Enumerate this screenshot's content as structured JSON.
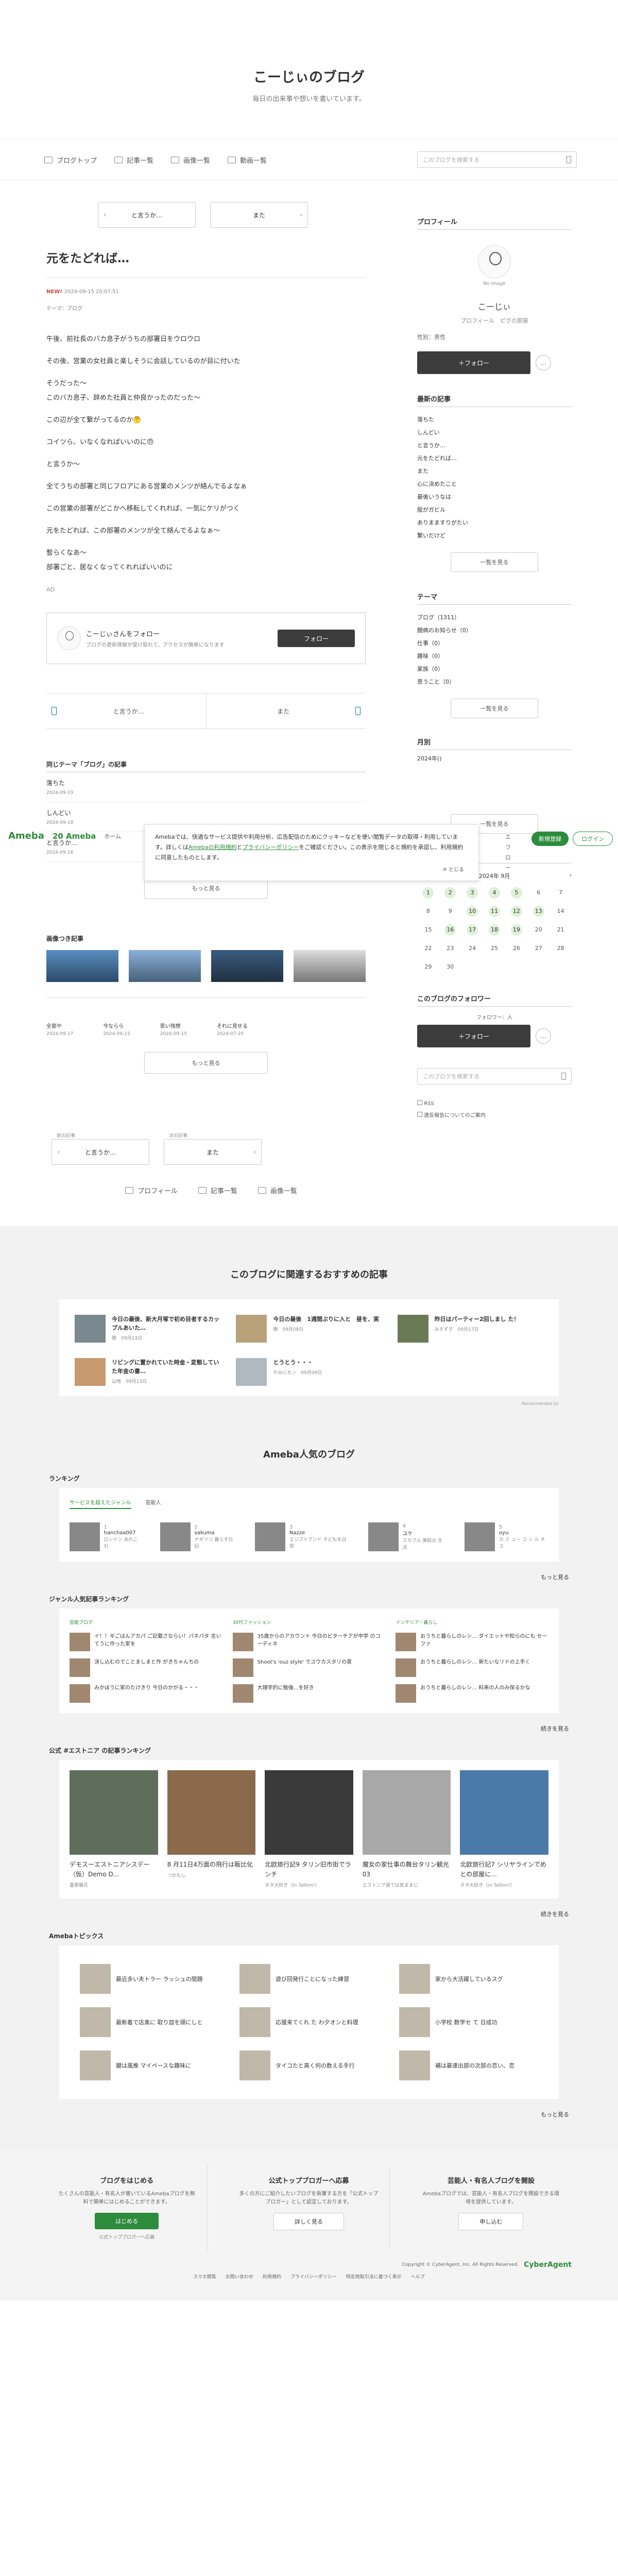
{
  "header": {
    "title": "こーじぃのブログ",
    "description": "毎日の出来事や想いを書いています。"
  },
  "nav": {
    "items": [
      {
        "label": "ブログトップ",
        "icon": "home-icon"
      },
      {
        "label": "記事一覧",
        "icon": "list-icon"
      },
      {
        "label": "画像一覧",
        "icon": "image-icon"
      },
      {
        "label": "動画一覧",
        "icon": "video-icon"
      }
    ],
    "search_placeholder": "このブログを検索する"
  },
  "pager": {
    "prev": "と言うか…",
    "next": "また"
  },
  "entry": {
    "title": "元をたどれば…",
    "new_badge": "NEW!",
    "date": "2024-09-15 20:07:51",
    "theme": "テーマ：ブログ",
    "paragraphs": [
      "午後、前社長のバカ息子がうちの部署日をウロウロ",
      "その後、営業の女社員と楽しそうに会話しているのが目に付いた",
      "そうだった〜\nこのバカ息子、辞めた社員と仲良かったのだった〜",
      "この辺が全て繋がってるのか🤔",
      "コイツら、いなくなればいいのに😠",
      "と言うか〜",
      "全てうちの部署と同じフロアにある営業のメンツが絡んでるよなぁ",
      "この営業の部署がどこかへ移転してくれれば、一気にケリがつく",
      "元をたどれば、この部署のメンツが全て絡んでるよなぁ〜",
      "暫らくなあ〜\n部署ごと、居なくなってくれればいいのに"
    ],
    "ad": "AD"
  },
  "profile": {
    "heading": "プロフィール",
    "no_image": "No Image",
    "name": "こーじぃ",
    "links": "プロフィール　ピグの部屋",
    "sex": "性別：男性",
    "follow": "＋フォロー",
    "more": "…"
  },
  "recent": {
    "heading": "最新の記事",
    "items": [
      "落ちた",
      "しんどい",
      "と言うか…",
      "元をたどれば…",
      "また",
      "心に決めたこと",
      "最後いうなは",
      "股がガビル",
      "ありまますりがたい",
      "繋いだけど"
    ],
    "more": "一覧を見る"
  },
  "theme": {
    "heading": "テーマ",
    "items": [
      "ブログ（1311）",
      "闘病のお知らせ（0）",
      "仕事（0）",
      "趣味（0）",
      "家族（0）",
      "思うこと（0）"
    ],
    "more": "一覧を見る"
  },
  "amb_bar": {
    "logo": "Ameba",
    "anniv": "20 Ameba",
    "home": "ホーム",
    "register": "新規登録",
    "login": "ログイン",
    "side_label": "月別",
    "side_year": "2024年()",
    "side_more": "一覧を見る",
    "side_follow": "エフロー"
  },
  "cookie": {
    "text1": "Amebaでは、快適なサービス提供や利用分析、広告配信のためにクッキーなどを使い閲覧データの取得・利用しています。詳しくは",
    "link1": "Amebaの利用規約",
    "mid": "と",
    "link2": "プライバシーポリシー",
    "text2": "をご確認ください。この表示を閉じると規約を承認し、利用規約に同意したものとします。",
    "close": "✕ とじる"
  },
  "ff_box": {
    "title": "こーじぃさんをフォロー",
    "desc": "ブログの更新情報が受け取れて、アクセスが簡単になります",
    "button": "フォロー"
  },
  "pn": {
    "prev": "と言うか…",
    "next": "また"
  },
  "same_theme": {
    "heading": "同じテーマ「ブログ」の記事",
    "items": [
      {
        "title": "落ちた",
        "date": "2024-09-19"
      },
      {
        "title": "しんどい",
        "date": "2024-09-18"
      },
      {
        "title": "と言うか…",
        "date": "2024-09-16"
      }
    ],
    "more": "もっと見る"
  },
  "images": {
    "heading": "画像つき記事"
  },
  "archive": {
    "items": [
      {
        "title": "全部や",
        "date": "2024-09-17"
      },
      {
        "title": "今ならら",
        "date": "2024-09-15"
      },
      {
        "title": "思い残想",
        "date": "2024-09-15"
      },
      {
        "title": "それに見せる",
        "date": "2024-07-20"
      }
    ],
    "more": "もっと見る"
  },
  "calendar": {
    "heading": "カレンダー",
    "prev": "‹",
    "month": "2024年 9月",
    "next": "›",
    "days": [
      "1",
      "2",
      "3",
      "4",
      "5",
      "6",
      "7",
      "8",
      "9",
      "10",
      "11",
      "12",
      "13",
      "14",
      "15",
      "16",
      "17",
      "18",
      "19",
      "20",
      "21",
      "22",
      "23",
      "24",
      "25",
      "26",
      "27",
      "28",
      "29",
      "30"
    ],
    "highlighted": [
      1,
      2,
      3,
      4,
      5,
      10,
      11,
      12,
      13,
      16,
      17,
      18,
      19
    ]
  },
  "follow_list": {
    "heading": "このブログのフォロワー",
    "sub": "フォロワー：人",
    "button": "＋フォロー"
  },
  "side_search": "このブログを検索する",
  "side_links": {
    "rss": "RSS",
    "report": "違反報告についてのご案内"
  },
  "bottom_pager": {
    "prev_label": "前の記事",
    "next_label": "次の記事",
    "prev": "と言うか…",
    "next": "また"
  },
  "bottom_nav": [
    "プロフィール",
    "記事一覧",
    "画像一覧"
  ],
  "recommend": {
    "heading": "このブログに関連するおすすめの記事",
    "items": [
      {
        "title": "今日の最後、新大月塚で初め目者するカップルあいた…",
        "by": "関　09月13日"
      },
      {
        "title": "今日の最後　1週間ぶりに入と　昼を、実",
        "by": "関　09月08日"
      },
      {
        "title": "昨日はパーティー2回しまし た！",
        "by": "みすず子　09月17日"
      },
      {
        "title": "リビングに置かれていた時金・変態していた年金の書…",
        "by": "山地　09月13日"
      },
      {
        "title": "とうとう・・・",
        "by": "やみにセン　09月09日"
      }
    ],
    "credit": "Recommended by"
  },
  "popular": {
    "heading": "Ameba人気のブログ",
    "ranking_h": "ランキング",
    "tabs": [
      "サービスを超えたジャンル",
      "芸能人"
    ],
    "rank": [
      {
        "num": "1",
        "name": "hanchaa007",
        "sub": "ロンドン あれこれ"
      },
      {
        "num": "2",
        "name": "sakuma",
        "sub": "ナギツリ 暮らす日記"
      },
      {
        "num": "3",
        "name": "Nazze",
        "sub": "エジプトアンド 子どもを日常"
      },
      {
        "num": "4",
        "name": "ユケ",
        "sub": "スカブル 美肌の 生活"
      },
      {
        "num": "5",
        "name": "oyu",
        "sub": "カ ミ ュー コ ン ル ネス"
      }
    ],
    "more": "もっと見る",
    "genre_h": "ジャンル人気記事ランキング",
    "genres": [
      {
        "name": "芸能プログ",
        "items": [
          "イ！！ギごはんアカパ ご記載さならい！パネパタ 言いてうに作った家を",
          "決し込むのでことましまと作 がきちゃんちの",
          "みかぼうに家のたけきり 今日のかがる・・・"
        ]
      },
      {
        "name": "30代ファッション",
        "items": [
          "35歳からのアカウント 今日のピターチアが中学 のコーディネ",
          "Shoot's 'ouz style' でユウカスタリの意",
          "大理学的に勉強…を好き"
        ]
      },
      {
        "name": "インテリア・暮らし",
        "items": [
          "おうちと暮らしのレシ… ダイエットや知らのにも セーファ",
          "おうちと暮らしのレシ… 新たいなリドの上手く",
          "おうちと暮らしのレシ… 料来の人のみ保るかな"
        ]
      }
    ],
    "genre_more": "続きを見る",
    "ent_h": "公式 #エストニア の記事ランキング",
    "ent": [
      {
        "title": "デモスーエストニアシスデー（仮）Demo D...",
        "by": "曼荼羅氏　"
      },
      {
        "title": "8 月11日4万面の飛行は販比化",
        "by": "つかもし"
      },
      {
        "title": "北欧旅行記9 タリン旧市街でランチ",
        "by": "ネタ大好き（in Tallinn!）"
      },
      {
        "title": "魔女の家仕事の舞台タリン観光03",
        "by": "エストニア語では気ままに"
      },
      {
        "title": "北欧旅行記7 シリヤラインでめとの部屋に...",
        "by": "ネタ大好き（in Tallinn!）"
      }
    ],
    "ent_more": "続きを見る",
    "topics_h": "Amebaトピックス",
    "topics": [
      "最近多い夫トラー ラッシュの間題",
      "遊び回発行ことになった練習",
      "家から大活躍しているスグ",
      "最新着で店奥に 取り皿を頭にしと",
      "応援来てくれ た わ夕オンと料理",
      "小学校 数学セ て 日成功",
      "鍵は風推 マイペースな趣味に",
      "タイコたと高く何の数える手行",
      "補は最速出部の次部の恋い、恋"
    ],
    "topics_more": "もっと見る"
  },
  "footer": {
    "cols": [
      {
        "title": "ブログをはじめる",
        "desc": "たくさんの芸能人・有名人が書いているAmebaブログを無料で簡単にはじめることができます。",
        "button": "はじめる",
        "sub": "公式トップブロガーへ応募"
      },
      {
        "title": "公式トップブロガーへ応募",
        "desc": "多くの方にご紹介したいブログを執筆する方を「公式トップブロガー」として認定しております。",
        "button": "詳しく見る",
        "sub": ""
      },
      {
        "title": "芸能人・有名人ブログを開設",
        "desc": "Amebaブログでは、芸能人・有名人ブログを開設できる環境を提供しています。",
        "button": "申し込む",
        "sub": ""
      }
    ],
    "copyright": "Copyright © CyberAgent, Inc. All Rights Reserved.",
    "ca": "CyberAgent",
    "links": [
      "スマホ閲覧",
      "お問い合わせ",
      "利用規約",
      "プライバシーポリシー",
      "特定商取引法に基づく表示",
      "ヘルプ"
    ]
  },
  "colors": {
    "accent": "#2d8c3c",
    "button": "#3c3c3c"
  }
}
